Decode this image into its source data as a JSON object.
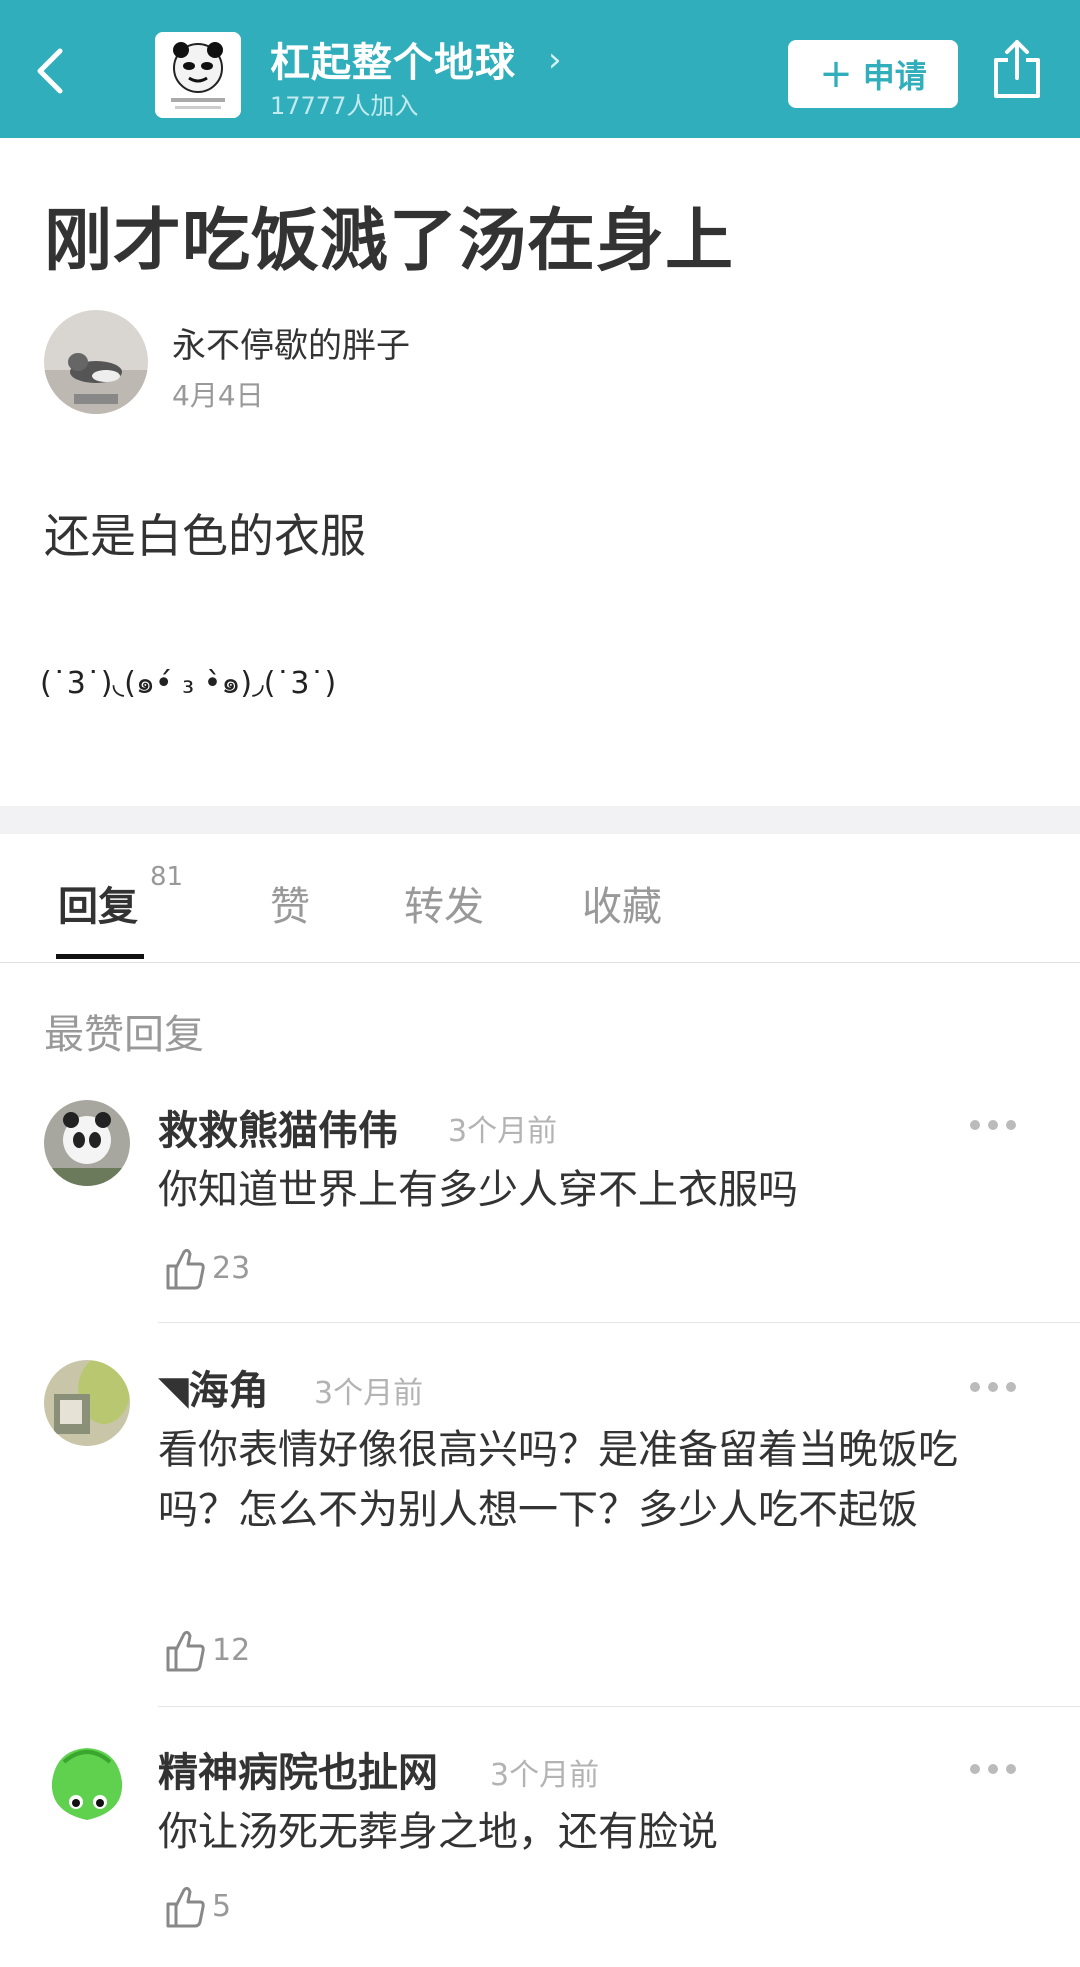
{
  "header": {
    "group_name": "杠起整个地球",
    "group_member_text": "17777人加入",
    "apply_label": "申请",
    "icons": [
      "back-arrow-icon",
      "chevron-right-icon",
      "plus-icon",
      "share-icon"
    ],
    "bg_color": "#30aebb"
  },
  "post": {
    "title": "刚才吃饭溅了汤在身上",
    "author": "永不停歇的胖子",
    "date": "4月4日",
    "body": "还是白色的衣服",
    "emoticon": "(˙3˙)◟(๑•́ ₃ •̀๑)◞(˙3˙)"
  },
  "tabs": [
    {
      "label": "回复",
      "count": "81",
      "active": true
    },
    {
      "label": "赞"
    },
    {
      "label": "转发"
    },
    {
      "label": "收藏"
    }
  ],
  "section_label": "最赞回复",
  "comments": [
    {
      "name": "救救熊猫伟伟",
      "time": "3个月前",
      "text": "你知道世界上有多少人穿不上衣服吗",
      "likes": "23"
    },
    {
      "name": "◥海角",
      "time": "3个月前",
      "text": "看你表情好像很高兴吗？是准备留着当晚饭吃吗？怎么不为别人想一下？多少人吃不起饭",
      "likes": "12"
    },
    {
      "name": "精神病院也扯网",
      "time": "3个月前",
      "text": "你让汤死无葬身之地，还有脸说",
      "likes": "5"
    }
  ]
}
